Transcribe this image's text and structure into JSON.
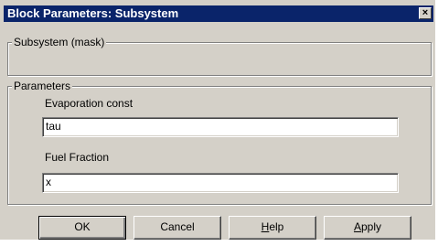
{
  "window": {
    "title": "Block Parameters: Subsystem",
    "close_glyph": "×"
  },
  "description_group": {
    "label": "Subsystem (mask)"
  },
  "parameters_group": {
    "label": "Parameters",
    "fields": [
      {
        "label": "Evaporation const",
        "value": "tau"
      },
      {
        "label": "Fuel Fraction",
        "value": "x"
      }
    ]
  },
  "buttons": {
    "ok": "OK",
    "cancel": "Cancel",
    "help_accel": "H",
    "help_rest": "elp",
    "apply_accel": "A",
    "apply_rest": "pply"
  },
  "icons": {
    "close": "close-icon"
  },
  "colors": {
    "titlebar": "#0a246a",
    "dialog_face": "#d4d0c8"
  }
}
